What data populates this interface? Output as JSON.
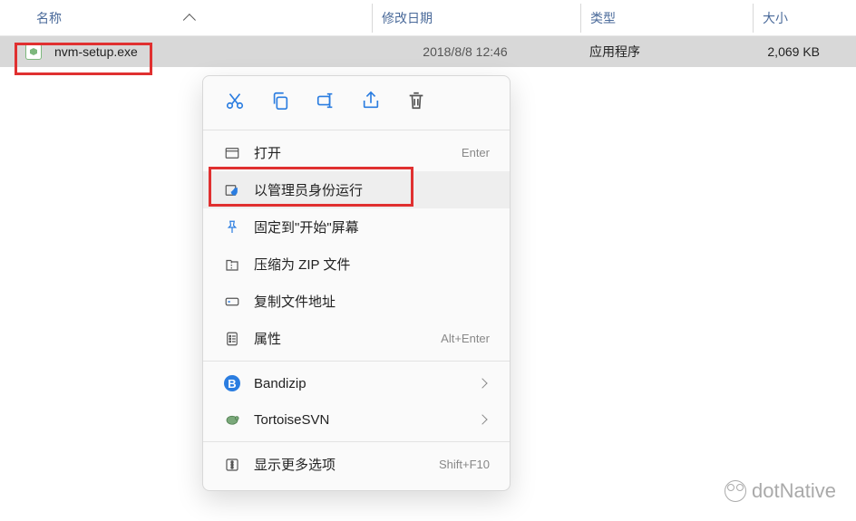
{
  "columns": {
    "name": "名称",
    "modified": "修改日期",
    "type": "类型",
    "size": "大小"
  },
  "file": {
    "name": "nvm-setup.exe",
    "modified": "2018/8/8 12:46",
    "type": "应用程序",
    "size": "2,069 KB"
  },
  "context_menu": {
    "toolbar": {
      "cut": "cut-icon",
      "copy": "copy-icon",
      "rename": "rename-icon",
      "share": "share-icon",
      "delete": "delete-icon"
    },
    "items": [
      {
        "icon": "open-icon",
        "label": "打开",
        "shortcut": "Enter",
        "submenu": false
      },
      {
        "icon": "shield-icon",
        "label": "以管理员身份运行",
        "shortcut": "",
        "submenu": false
      },
      {
        "icon": "pin-icon",
        "label": "固定到\"开始\"屏幕",
        "shortcut": "",
        "submenu": false
      },
      {
        "icon": "zip-icon",
        "label": "压缩为 ZIP 文件",
        "shortcut": "",
        "submenu": false
      },
      {
        "icon": "copy-path-icon",
        "label": "复制文件地址",
        "shortcut": "",
        "submenu": false
      },
      {
        "icon": "properties-icon",
        "label": "属性",
        "shortcut": "Alt+Enter",
        "submenu": false
      }
    ],
    "apps": [
      {
        "icon": "bandizip-icon",
        "label": "Bandizip",
        "submenu": true
      },
      {
        "icon": "tortoisesvn-icon",
        "label": "TortoiseSVN",
        "submenu": true
      }
    ],
    "more": {
      "icon": "more-icon",
      "label": "显示更多选项",
      "shortcut": "Shift+F10"
    }
  },
  "watermark": "dotNative"
}
